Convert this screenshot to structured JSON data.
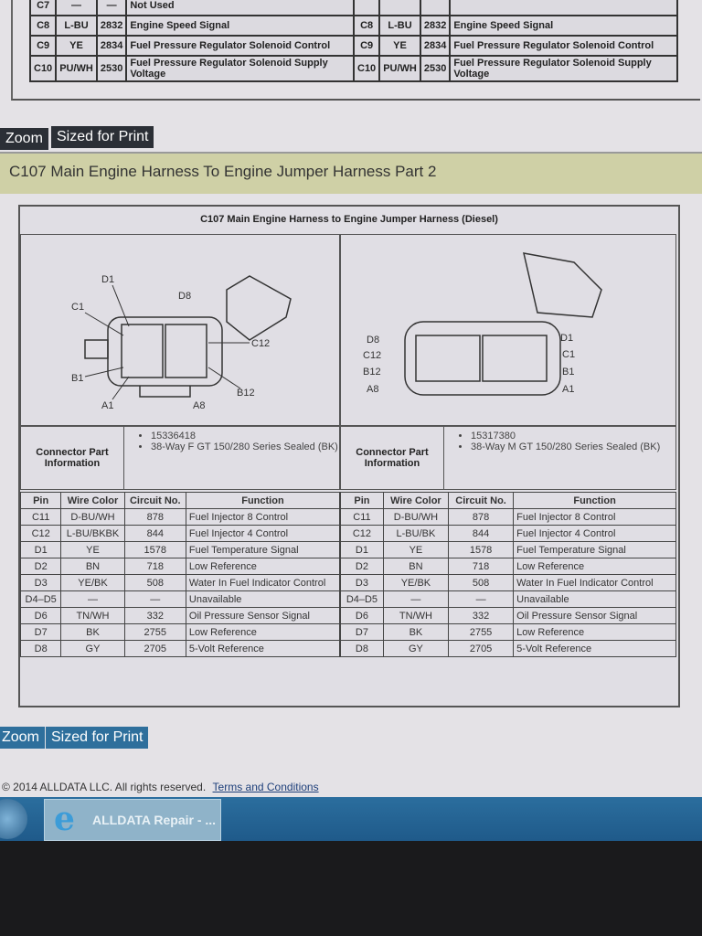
{
  "top_table": {
    "left_rows": [
      [
        "C7",
        "—",
        "—",
        "Not Used"
      ],
      [
        "C8",
        "L-BU",
        "2832",
        "Engine Speed Signal"
      ],
      [
        "C9",
        "YE",
        "2834",
        "Fuel Pressure Regulator Solenoid Control"
      ],
      [
        "C10",
        "PU/WH",
        "2530",
        "Fuel Pressure Regulator Solenoid Supply Voltage"
      ]
    ],
    "right_rows": [
      [
        "C8",
        "L-BU",
        "2832",
        "Engine Speed Signal"
      ],
      [
        "C9",
        "YE",
        "2834",
        "Fuel Pressure Regulator Solenoid Control"
      ],
      [
        "C10",
        "PU/WH",
        "2530",
        "Fuel Pressure Regulator Solenoid Supply Voltage"
      ]
    ]
  },
  "buttons_top": {
    "zoom": "Zoom",
    "print": "Sized for Print"
  },
  "section_title": "C107 Main Engine Harness To Engine Jumper Harness Part 2",
  "diagram": {
    "title": "C107 Main Engine Harness to Engine Jumper Harness (Diesel)",
    "left_labels": {
      "d1": "D1",
      "d8": "D8",
      "c1": "C1",
      "c12": "C12",
      "b1": "B1",
      "b12": "B12",
      "a1": "A1",
      "a8": "A8"
    },
    "right_labels": {
      "d8": "D8",
      "c12": "C12",
      "b12": "B12",
      "a8": "A8",
      "d1": "D1",
      "c1": "C1",
      "b1": "B1",
      "a1": "A1"
    },
    "columns": [
      "Pin",
      "Wire Color",
      "Circuit No.",
      "Function"
    ],
    "connector_info_label": "Connector Part Information",
    "left": {
      "part_info": [
        "15336418",
        "38-Way F GT 150/280 Series Sealed (BK)"
      ],
      "rows": [
        [
          "C11",
          "D-BU/WH",
          "878",
          "Fuel Injector 8 Control"
        ],
        [
          "C12",
          "L-BU/BKBK",
          "844",
          "Fuel Injector 4 Control"
        ],
        [
          "D1",
          "YE",
          "1578",
          "Fuel Temperature Signal"
        ],
        [
          "D2",
          "BN",
          "718",
          "Low Reference"
        ],
        [
          "D3",
          "YE/BK",
          "508",
          "Water In Fuel Indicator Control"
        ],
        [
          "D4–D5",
          "—",
          "—",
          "Unavailable"
        ],
        [
          "D6",
          "TN/WH",
          "332",
          "Oil Pressure Sensor Signal"
        ],
        [
          "D7",
          "BK",
          "2755",
          "Low Reference"
        ],
        [
          "D8",
          "GY",
          "2705",
          "5-Volt Reference"
        ]
      ]
    },
    "right": {
      "part_info": [
        "15317380",
        "38-Way M GT 150/280 Series Sealed (BK)"
      ],
      "rows": [
        [
          "C11",
          "D-BU/WH",
          "878",
          "Fuel Injector 8 Control"
        ],
        [
          "C12",
          "L-BU/BK",
          "844",
          "Fuel Injector 4 Control"
        ],
        [
          "D1",
          "YE",
          "1578",
          "Fuel Temperature Signal"
        ],
        [
          "D2",
          "BN",
          "718",
          "Low Reference"
        ],
        [
          "D3",
          "YE/BK",
          "508",
          "Water In Fuel Indicator Control"
        ],
        [
          "D4–D5",
          "—",
          "—",
          "Unavailable"
        ],
        [
          "D6",
          "TN/WH",
          "332",
          "Oil Pressure Sensor Signal"
        ],
        [
          "D7",
          "BK",
          "2755",
          "Low Reference"
        ],
        [
          "D8",
          "GY",
          "2705",
          "5-Volt Reference"
        ]
      ]
    }
  },
  "buttons_bottom": {
    "zoom": "Zoom",
    "print": "Sized for Print"
  },
  "footer": {
    "copyright": "© 2014 ALLDATA LLC. All rights reserved.",
    "terms_link": "Terms and Conditions"
  },
  "taskbar": {
    "item_label": "ALLDATA Repair - ...",
    "icons": {
      "start": "windows-start-icon",
      "browser": "internet-explorer-icon"
    }
  },
  "colors": {
    "button_dark": "#2b2f36",
    "button_blue": "#2e6f9c",
    "title_band": "#cfd0a6",
    "taskbar": "#2b6e9e"
  }
}
